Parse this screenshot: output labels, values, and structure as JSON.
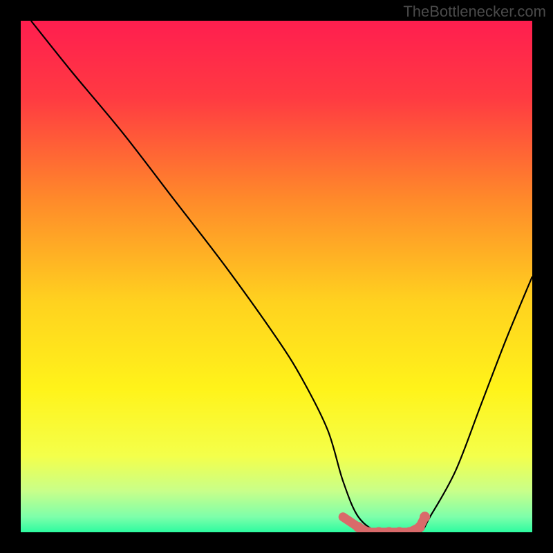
{
  "attribution": "TheBottlenecker.com",
  "chart_data": {
    "type": "line",
    "title": "",
    "xlabel": "",
    "ylabel": "",
    "xlim": [
      0,
      100
    ],
    "ylim": [
      0,
      100
    ],
    "series": [
      {
        "name": "bottleneck-curve",
        "x": [
          2,
          10,
          20,
          30,
          40,
          50,
          55,
          60,
          63,
          66,
          70,
          74,
          78,
          80,
          85,
          90,
          95,
          100
        ],
        "y": [
          100,
          90,
          78,
          65,
          52,
          38,
          30,
          20,
          10,
          3,
          0,
          0,
          0,
          3,
          12,
          25,
          38,
          50
        ]
      }
    ],
    "highlight_points": {
      "name": "optimal-range",
      "x": [
        63,
        66,
        68,
        70,
        72,
        74,
        76,
        78,
        79
      ],
      "y": [
        3,
        1,
        0,
        0,
        0,
        0,
        0,
        1,
        3
      ]
    },
    "background": {
      "type": "vertical-gradient",
      "stops": [
        {
          "pos": 0.0,
          "color": "#ff1e4f"
        },
        {
          "pos": 0.15,
          "color": "#ff3a42"
        },
        {
          "pos": 0.35,
          "color": "#ff8a2a"
        },
        {
          "pos": 0.55,
          "color": "#ffd21f"
        },
        {
          "pos": 0.72,
          "color": "#fff31a"
        },
        {
          "pos": 0.85,
          "color": "#f4ff4a"
        },
        {
          "pos": 0.92,
          "color": "#c8ff8a"
        },
        {
          "pos": 0.97,
          "color": "#7dffaa"
        },
        {
          "pos": 1.0,
          "color": "#2dfba0"
        }
      ]
    },
    "curve_color": "#000000",
    "highlight_color": "#d96a6a"
  }
}
